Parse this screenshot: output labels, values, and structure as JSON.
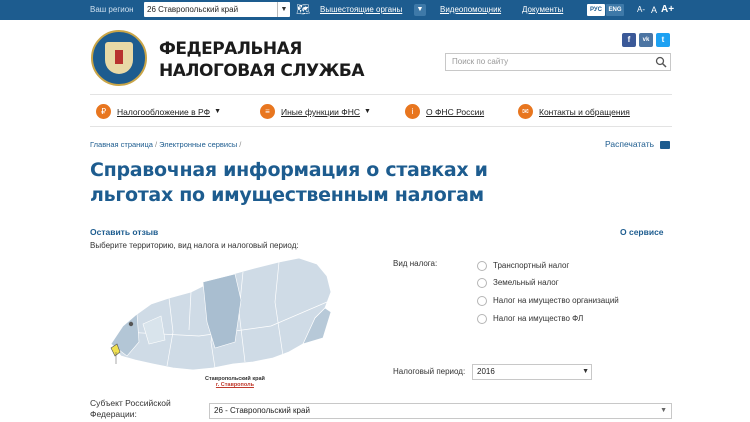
{
  "topbar": {
    "region_label": "Ваш регион",
    "region_value": "26 Ставропольский край",
    "higher_bodies": "Вышестоящие органы",
    "video_helper": "Видеопомощник",
    "documents": "Документы",
    "lang_ru": "РУС",
    "lang_en": "ENG",
    "font_small": "A-",
    "font_normal": "A",
    "font_large": "A+"
  },
  "header": {
    "brand_line1": "ФЕДЕРАЛЬНАЯ",
    "brand_line2": "НАЛОГОВАЯ СЛУЖБА",
    "social": {
      "facebook": "f",
      "vk": "vk",
      "twitter": "t"
    },
    "search_placeholder": "Поиск по сайту"
  },
  "nav": [
    {
      "label": "Налогообложение в РФ",
      "icon": "₽",
      "dropdown": true
    },
    {
      "label": "Иные функции ФНС",
      "icon": "≡",
      "dropdown": true
    },
    {
      "label": "О ФНС России",
      "icon": "i",
      "dropdown": false
    },
    {
      "label": "Контакты и обращения",
      "icon": "✉",
      "dropdown": false
    }
  ],
  "breadcrumb": {
    "home": "Главная страница",
    "services": "Электронные сервисы"
  },
  "print_label": "Распечатать",
  "page_title": "Справочная информация о ставках и льготах по имущественным налогам",
  "leave_feedback": "Оставить отзыв",
  "about_service": "О сервисе",
  "choose_text": "Выберите территорию, вид налога и налоговый период:",
  "map": {
    "label_region": "Ставропольский край",
    "label_city": "г. Ставрополь"
  },
  "tax_type": {
    "label": "Вид налога:",
    "options": [
      "Транспортный налог",
      "Земельный налог",
      "Налог на имущество организаций",
      "Налог на имущество ФЛ"
    ]
  },
  "period": {
    "label": "Налоговый период:",
    "value": "2016"
  },
  "subject": {
    "label": "Субъект Российской Федерации:",
    "value": "26 - Ставропольский край"
  },
  "colors": {
    "brand_blue": "#1d5c8f",
    "accent_orange": "#e8761f"
  }
}
